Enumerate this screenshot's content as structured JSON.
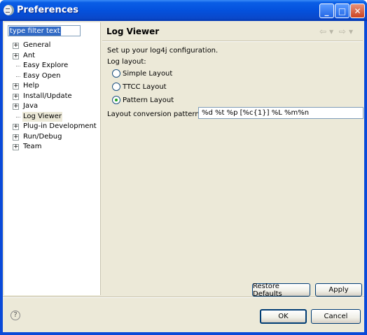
{
  "window": {
    "title": "Preferences"
  },
  "title_buttons": {
    "minimize": "_",
    "maximize": "□",
    "close": "✕"
  },
  "filter": {
    "value": "type filter text"
  },
  "tree": [
    {
      "label": "General",
      "expandable": true
    },
    {
      "label": "Ant",
      "expandable": true
    },
    {
      "label": "Easy Explore",
      "expandable": false
    },
    {
      "label": "Easy Open",
      "expandable": false
    },
    {
      "label": "Help",
      "expandable": true
    },
    {
      "label": "Install/Update",
      "expandable": true
    },
    {
      "label": "Java",
      "expandable": true
    },
    {
      "label": "Log Viewer",
      "expandable": false,
      "selected": true
    },
    {
      "label": "Plug-in Development",
      "expandable": true
    },
    {
      "label": "Run/Debug",
      "expandable": true
    },
    {
      "label": "Team",
      "expandable": true
    }
  ],
  "page": {
    "title": "Log Viewer",
    "description": "Set up your log4j configuration.",
    "layout_label": "Log layout:",
    "options": [
      {
        "label": "Simple Layout",
        "checked": false
      },
      {
        "label": "TTCC Layout",
        "checked": false
      },
      {
        "label": "Pattern Layout",
        "checked": true
      }
    ],
    "pattern_label": "Layout conversion pattern:",
    "pattern_value": "%d %t %p [%c{1}] %L %m%n"
  },
  "buttons": {
    "restore": "Restore Defaults",
    "apply": "Apply",
    "ok": "OK",
    "cancel": "Cancel"
  },
  "icons": {
    "help": "?",
    "back": "⇦",
    "forward": "⇨",
    "dropdown": "▾"
  },
  "colors": {
    "titlebar": "#0451dd",
    "dialog_bg": "#ece9d8",
    "selection": "#316ac5",
    "radio_dot": "#21a121"
  }
}
